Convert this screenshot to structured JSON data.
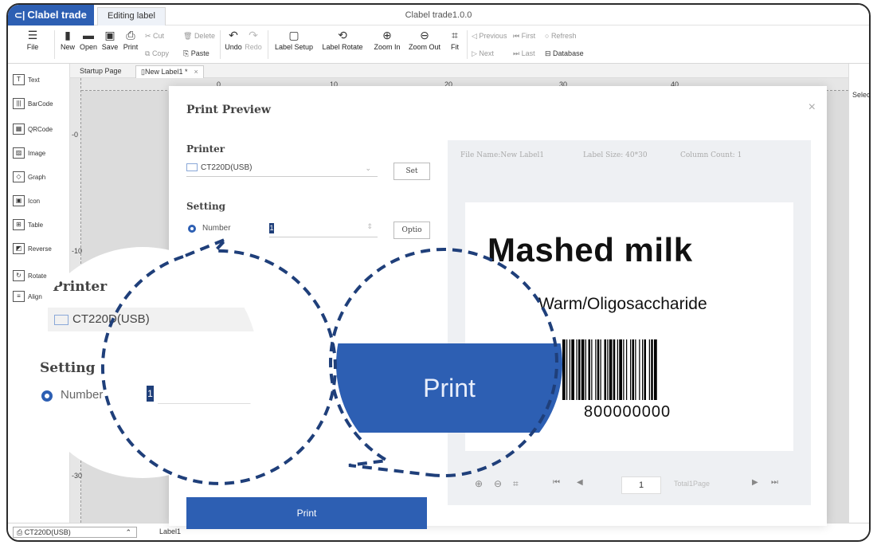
{
  "titlebar": {
    "brand": "Clabel trade",
    "tab": "Editing label",
    "title": "Clabel trade1.0.0"
  },
  "toolbar": {
    "file": "File",
    "new": "New",
    "open": "Open",
    "save": "Save",
    "print": "Print",
    "cut": "Cut",
    "copy": "Copy",
    "delete": "Delete",
    "paste": "Paste",
    "undo": "Undo",
    "redo": "Redo",
    "label_setup": "Label Setup",
    "label_rotate": "Label Rotate",
    "zoom_in": "Zoom In",
    "zoom_out": "Zoom Out",
    "fit": "Fit",
    "previous": "Previous",
    "next": "Next",
    "first": "First",
    "last": "Last",
    "refresh": "Refresh",
    "database": "Database"
  },
  "sidebar": {
    "items": [
      {
        "label": "Text",
        "icon": "T"
      },
      {
        "label": "BarCode",
        "icon": "|||"
      },
      {
        "label": "QRCode",
        "icon": "▦"
      },
      {
        "label": "Image",
        "icon": "▨"
      },
      {
        "label": "Graph",
        "icon": "◇"
      },
      {
        "label": "Icon",
        "icon": "▣"
      },
      {
        "label": "Table",
        "icon": "⊞"
      },
      {
        "label": "Reverse",
        "icon": "◩"
      },
      {
        "label": "Rotate",
        "icon": "↻"
      },
      {
        "label": "Align",
        "icon": "≡"
      }
    ]
  },
  "doc_tabs": {
    "startup": "Startup Page",
    "label": "New Label1 *"
  },
  "ruler": {
    "top": [
      "0",
      "10",
      "20",
      "30",
      "40"
    ],
    "left": [
      "-0",
      "-10",
      "-30"
    ]
  },
  "right_panel": {
    "label": "Selec"
  },
  "status": {
    "printer": "CT220D(USB)",
    "label": "Label1"
  },
  "dialog": {
    "title": "Print Preview",
    "printer_heading": "Printer",
    "printer_value": "CT220D(USB)",
    "set_button": "Set",
    "setting_heading": "Setting",
    "number_label": "Number",
    "number_value": "1",
    "option_button": "Optio",
    "print_button": "Print",
    "close": "×"
  },
  "preview": {
    "file_name": "File Name:New Label1",
    "label_size": "Label Size: 40*30",
    "column_count": "Column Count: 1",
    "label_title": "Mashed milk",
    "label_subtitle": "Warm/Oligosaccharide",
    "label_code": "800000000",
    "page": "1",
    "total": "Total1Page"
  },
  "callout_left": {
    "printer_heading": "Printer",
    "printer_value": "CT220D(USB)",
    "setting_heading": "Setting",
    "number_label": "Number",
    "number_value": "1"
  },
  "callout_right": {
    "print_button": "Print"
  },
  "colors": {
    "accent": "#2d5fb3",
    "dashes": "#1f3f7a"
  }
}
